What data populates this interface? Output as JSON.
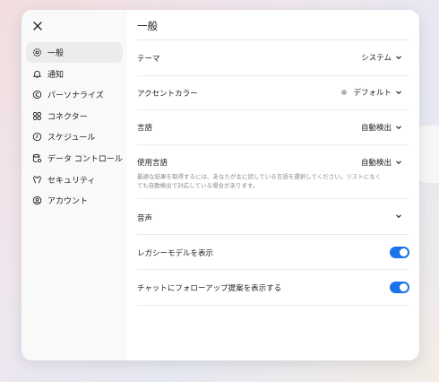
{
  "sidebar": {
    "close_icon": "close-icon",
    "items": [
      {
        "label": "一般",
        "icon": "gear-icon",
        "active": true
      },
      {
        "label": "通知",
        "icon": "bell-icon"
      },
      {
        "label": "パーソナライズ",
        "icon": "personalize-icon"
      },
      {
        "label": "コネクター",
        "icon": "connector-icon"
      },
      {
        "label": "スケジュール",
        "icon": "clock-icon"
      },
      {
        "label": "データ コントロール",
        "icon": "data-control-icon"
      },
      {
        "label": "セキュリティ",
        "icon": "security-icon"
      },
      {
        "label": "アカウント",
        "icon": "account-icon"
      }
    ]
  },
  "main": {
    "title": "一般",
    "theme": {
      "label": "テーマ",
      "value": "システム"
    },
    "accent": {
      "label": "アクセントカラー",
      "value": "デフォルト",
      "dot_color": "#b3b3b3"
    },
    "language": {
      "label": "言語",
      "value": "自動検出"
    },
    "spoken_language": {
      "label": "使用言語",
      "value": "自動検出",
      "description": "最適な結果を取得するには、あなたが主に話している言語を選択してください。リストになくても自動検出で対応している場合があります。"
    },
    "voice": {
      "label": "音声"
    },
    "legacy_models": {
      "label": "レガシーモデルを表示",
      "enabled": true
    },
    "follow_up": {
      "label": "チャットにフォローアップ提案を表示する",
      "enabled": true
    }
  },
  "colors": {
    "toggle_on": "#1a73e8"
  }
}
